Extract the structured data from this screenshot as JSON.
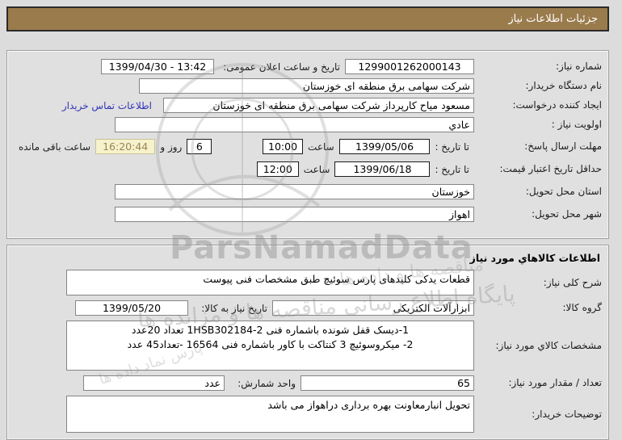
{
  "title_bar": {
    "text": "جزئیات اطلاعات نیاز"
  },
  "colors": {
    "titlebar_bg": "#9a7b4c",
    "page_bg": "#dcdcdc",
    "link": "#3434b8",
    "countdown_bg": "#f5f2cc",
    "countdown_text": "#9a8656"
  },
  "need_info": {
    "need_number_label": "شماره نیاز:",
    "need_number": "1299001262000143",
    "announce_label": "تاریخ و ساعت اعلان عمومی:",
    "announce_value": "1399/04/30 - 13:42",
    "buyer_label": "نام دستگاه خریدار:",
    "buyer_value": "شرکت سهامی برق منطقه ای خوزستان",
    "creator_label": "ایجاد کننده درخواست:",
    "creator_value": "مسعود میاح کارپرداز شرکت سهامی برق منطقه ای خوزستان",
    "contact_link": "اطلاعات تماس خریدار",
    "priority_label": "اولویت نیاز :",
    "priority_value": "عادي",
    "deadline_label": "مهلت ارسال پاسخ:",
    "until_date_label": "تا تاریخ :",
    "deadline_date": "1399/05/06",
    "hour_label": "ساعت",
    "deadline_time": "10:00",
    "days_remaining": "6",
    "days_and_label": "روز و",
    "time_remaining": "16:20:44",
    "remaining_label": "ساعت باقی مانده",
    "validity_label": "حداقل تاریخ اعتبار قیمت:",
    "validity_date": "1399/06/18",
    "validity_time": "12:00",
    "province_label": "استان محل تحویل:",
    "province_value": "خوزستان",
    "city_label": "شهر محل تحویل:",
    "city_value": "اهواز"
  },
  "goods_info": {
    "section_title": "اطلاعات کالاهاي مورد نیاز",
    "desc_label": "شرح کلی نیاز:",
    "desc_value": "قطعات یدکی کلیدهای پارس سوئیچ طبق مشخصات فنی پیوست",
    "group_label": "گروه کالا:",
    "group_value": "ابزارآلات الکتریکی",
    "need_date_label": "تاریخ نیاز به کالا:",
    "need_date": "1399/05/20",
    "specs_label": "مشخصات کالاي مورد نیاز:",
    "specs_line1": "1-دیسک قفل شونده باشماره فنی 1HSB302184-2 تعداد 20عدد",
    "specs_line2": "2- میکروسوئیچ 3 کنتاکت با کاور باشماره فنی 16564 -تعداد45 عدد",
    "qty_label": "تعداد / مقدار مورد نیاز:",
    "qty_value": "65",
    "unit_label": "واحد شمارش:",
    "unit_value": "عدد",
    "notes_label": "توضیحات خریدار:",
    "notes_value": "تحویل انبارمعاونت بهره برداری دراهواز می باشد"
  },
  "watermark": {
    "brand": "ParsNamadData",
    "phrase1": "پایگاه اطلاع رسانی مناقصه ها و مزایده ها",
    "phrase2": "مناقصه ها و داده ها",
    "phrase3": "پارس نماد داده ها"
  }
}
